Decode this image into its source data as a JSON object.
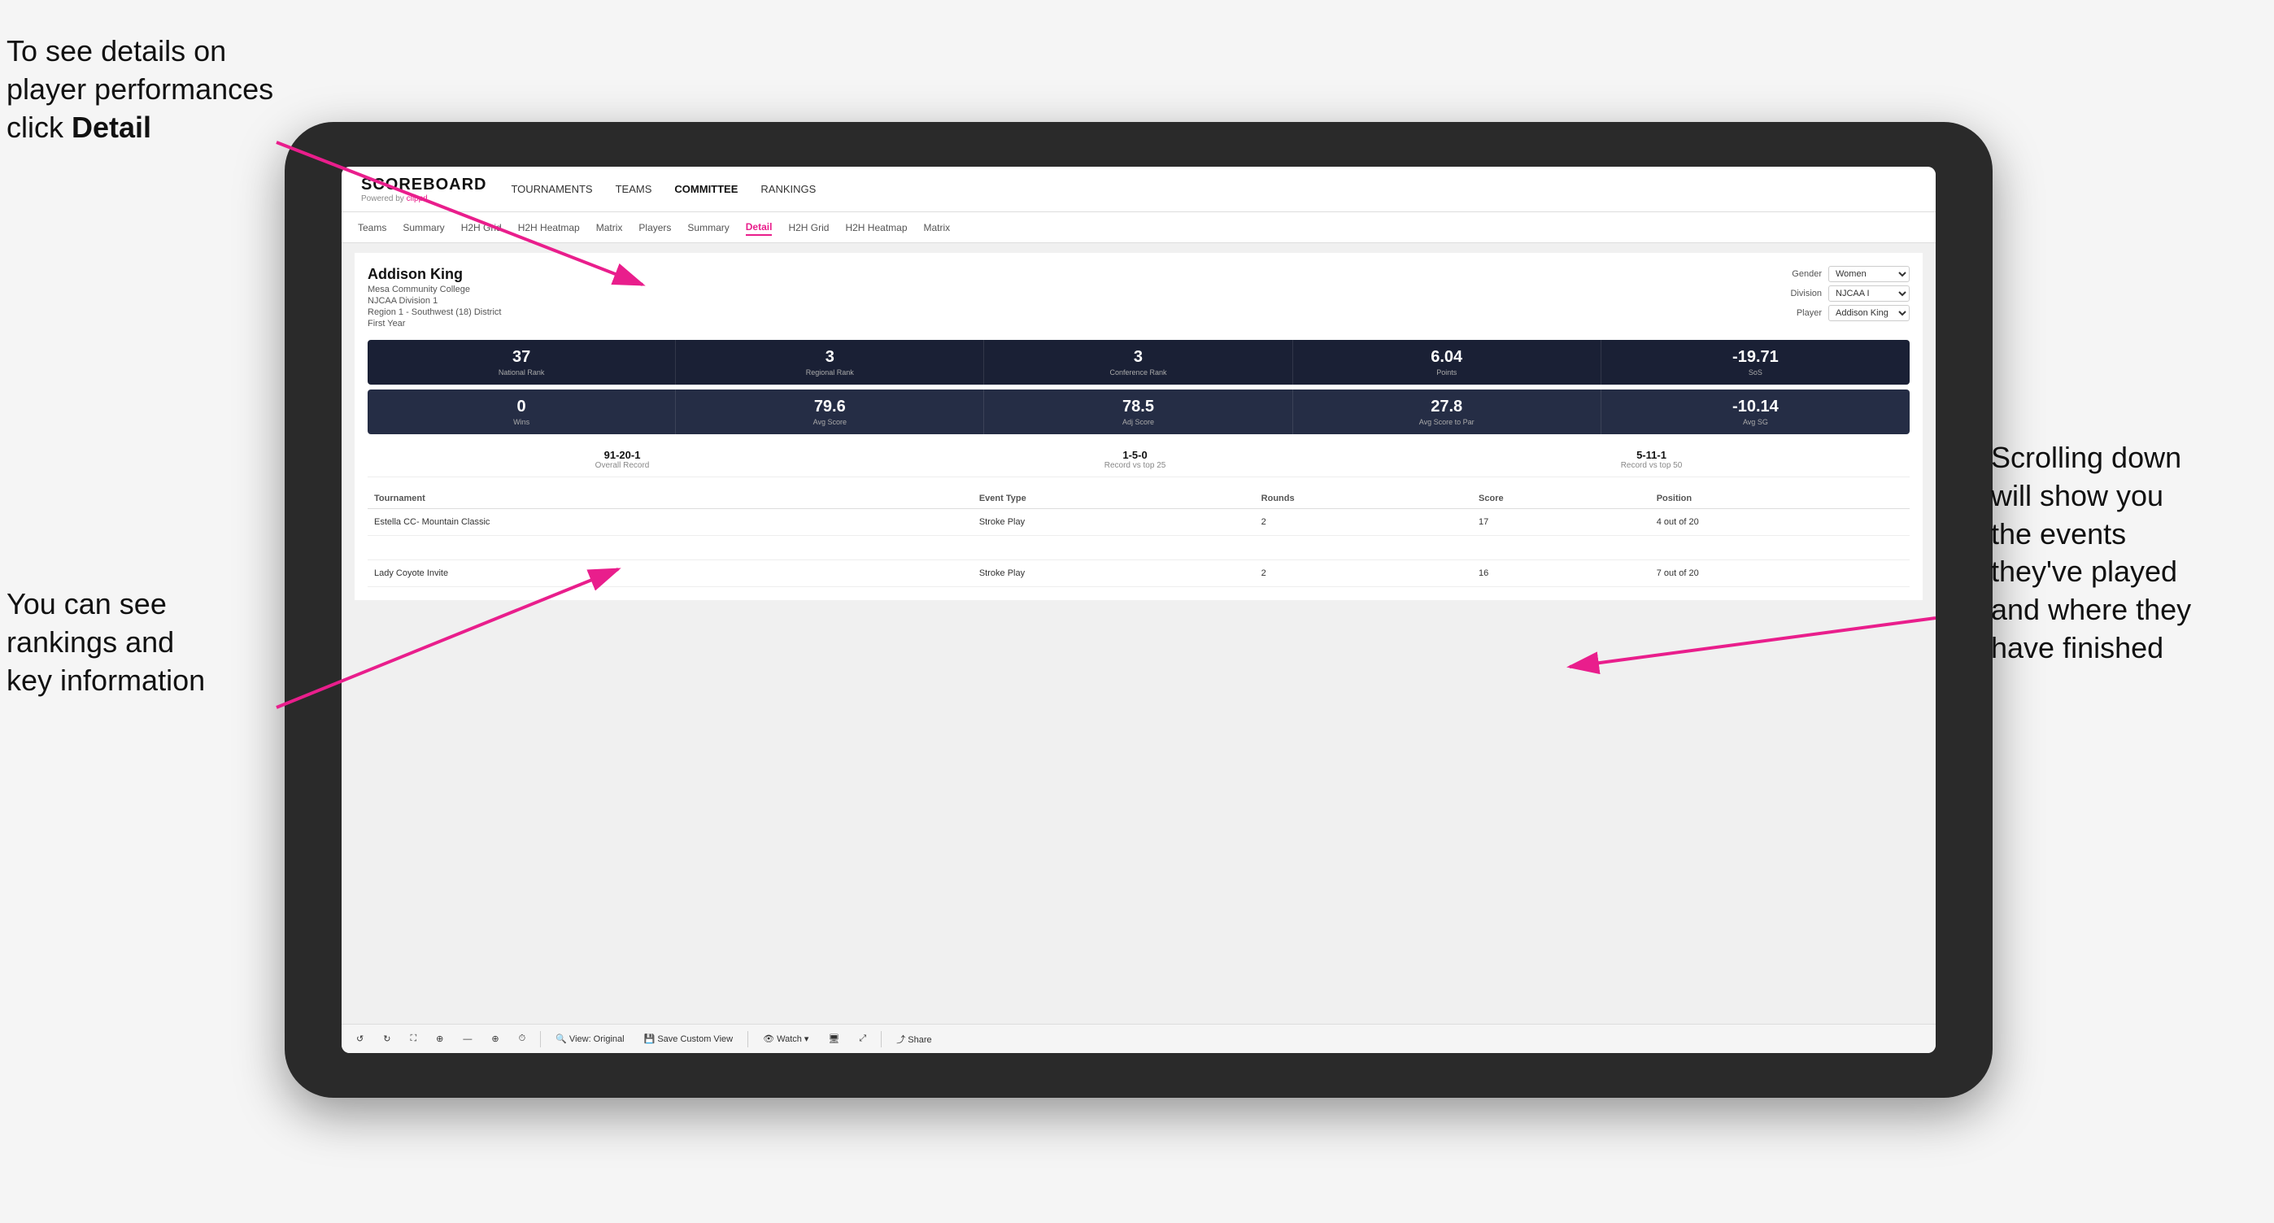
{
  "annotations": {
    "detail": {
      "line1": "To see details on",
      "line2": "player performances",
      "line3_prefix": "click ",
      "line3_bold": "Detail"
    },
    "rankings": {
      "line1": "You can see",
      "line2": "rankings and",
      "line3": "key information"
    },
    "scroll": {
      "line1": "Scrolling down",
      "line2": "will show you",
      "line3": "the events",
      "line4": "they've played",
      "line5": "and where they",
      "line6": "have finished"
    }
  },
  "nav": {
    "logo": "SCOREBOARD",
    "powered_by": "Powered by ",
    "clippd": "clippd",
    "items": [
      {
        "label": "TOURNAMENTS",
        "active": false
      },
      {
        "label": "TEAMS",
        "active": false
      },
      {
        "label": "COMMITTEE",
        "active": true
      },
      {
        "label": "RANKINGS",
        "active": false
      }
    ]
  },
  "sub_nav": {
    "items": [
      {
        "label": "Teams",
        "active": false
      },
      {
        "label": "Summary",
        "active": false
      },
      {
        "label": "H2H Grid",
        "active": false
      },
      {
        "label": "H2H Heatmap",
        "active": false
      },
      {
        "label": "Matrix",
        "active": false
      },
      {
        "label": "Players",
        "active": false
      },
      {
        "label": "Summary",
        "active": false
      },
      {
        "label": "Detail",
        "active": true
      },
      {
        "label": "H2H Grid",
        "active": false
      },
      {
        "label": "H2H Heatmap",
        "active": false
      },
      {
        "label": "Matrix",
        "active": false
      }
    ]
  },
  "player": {
    "name": "Addison King",
    "college": "Mesa Community College",
    "division": "NJCAA Division 1",
    "region": "Region 1 - Southwest (18) District",
    "year": "First Year"
  },
  "selectors": {
    "gender_label": "Gender",
    "gender_value": "Women",
    "division_label": "Division",
    "division_value": "NJCAA I",
    "player_label": "Player",
    "player_value": "Addison King"
  },
  "stats_row1": [
    {
      "value": "37",
      "label": "National Rank"
    },
    {
      "value": "3",
      "label": "Regional Rank"
    },
    {
      "value": "3",
      "label": "Conference Rank"
    },
    {
      "value": "6.04",
      "label": "Points"
    },
    {
      "value": "-19.71",
      "label": "SoS"
    }
  ],
  "stats_row2": [
    {
      "value": "0",
      "label": "Wins"
    },
    {
      "value": "79.6",
      "label": "Avg Score"
    },
    {
      "value": "78.5",
      "label": "Adj Score"
    },
    {
      "value": "27.8",
      "label": "Avg Score to Par"
    },
    {
      "value": "-10.14",
      "label": "Avg SG"
    }
  ],
  "records": [
    {
      "value": "91-20-1",
      "label": "Overall Record"
    },
    {
      "value": "1-5-0",
      "label": "Record vs top 25"
    },
    {
      "value": "5-11-1",
      "label": "Record vs top 50"
    }
  ],
  "table": {
    "headers": [
      "Tournament",
      "Event Type",
      "Rounds",
      "Score",
      "Position"
    ],
    "rows": [
      {
        "tournament": "Estella CC- Mountain Classic",
        "event_type": "Stroke Play",
        "rounds": "2",
        "score": "17",
        "position": "4 out of 20"
      },
      {
        "tournament": "",
        "event_type": "",
        "rounds": "",
        "score": "",
        "position": ""
      },
      {
        "tournament": "Lady Coyote Invite",
        "event_type": "Stroke Play",
        "rounds": "2",
        "score": "16",
        "position": "7 out of 20"
      }
    ]
  },
  "toolbar": {
    "buttons": [
      {
        "label": "↺",
        "text": ""
      },
      {
        "label": "↻",
        "text": ""
      },
      {
        "label": "⛶",
        "text": ""
      },
      {
        "label": "⊕",
        "text": ""
      },
      {
        "label": "—",
        "text": ""
      },
      {
        "label": "⊕",
        "text": ""
      },
      {
        "label": "⏱",
        "text": ""
      },
      {
        "label": "🔍",
        "text": "View: Original"
      },
      {
        "label": "💾",
        "text": "Save Custom View"
      },
      {
        "label": "👁",
        "text": "Watch ▾"
      },
      {
        "label": "🖥",
        "text": ""
      },
      {
        "label": "⤢",
        "text": ""
      },
      {
        "label": "Share",
        "text": "Share"
      }
    ]
  }
}
